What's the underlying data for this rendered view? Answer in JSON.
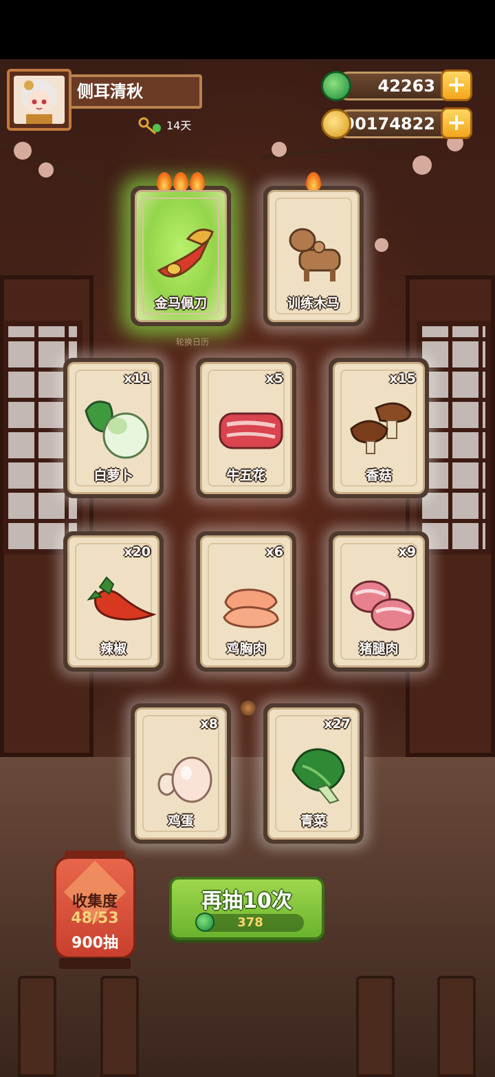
{
  "player": {
    "name": "侧耳清秋",
    "days_label": "14天"
  },
  "currencies": {
    "jade": "42263",
    "coins": "90174822"
  },
  "caption": "轮换日历",
  "cards": [
    {
      "label": "金马佩刀",
      "count": "",
      "flames": 3,
      "highlight": "green"
    },
    {
      "label": "训练木马",
      "count": "",
      "flames": 1,
      "highlight": "none"
    },
    {
      "label": "白萝卜",
      "count": "x11"
    },
    {
      "label": "牛五花",
      "count": "x5"
    },
    {
      "label": "香菇",
      "count": "x15"
    },
    {
      "label": "辣椒",
      "count": "x20"
    },
    {
      "label": "鸡胸肉",
      "count": "x6"
    },
    {
      "label": "猪腿肉",
      "count": "x9"
    },
    {
      "label": "鸡蛋",
      "count": "x8"
    },
    {
      "label": "青菜",
      "count": "x27"
    }
  ],
  "collection": {
    "title": "收集度",
    "progress": "48/53",
    "draws": "900抽"
  },
  "draw_button": {
    "label": "再抽10次",
    "cost": "378"
  },
  "colors": {
    "highlight_green": "#94d54a",
    "button_green": "#6ab32d",
    "plus_yellow": "#f2a71c"
  }
}
